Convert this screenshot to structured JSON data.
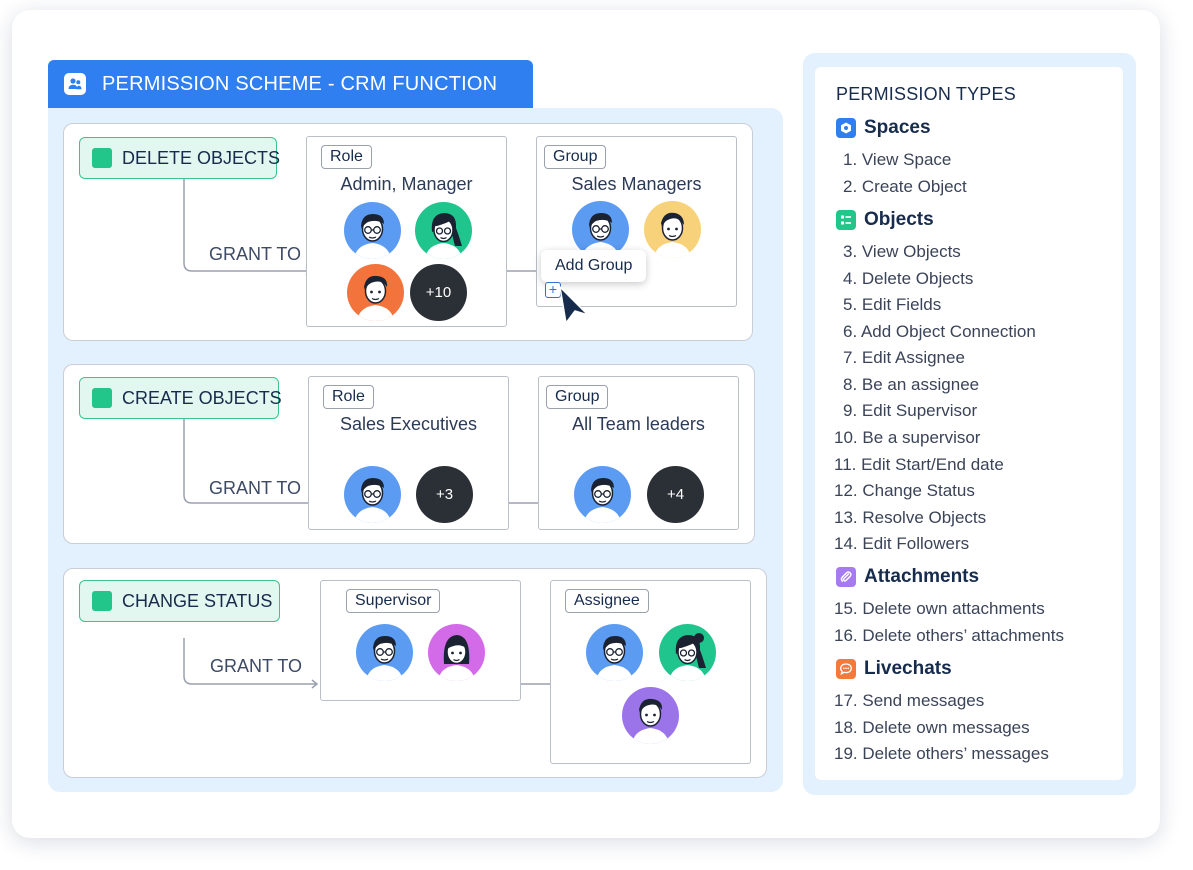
{
  "scheme": {
    "title": "PERMISSION SCHEME - CRM FUNCTION",
    "icon": "users-icon"
  },
  "grant_label": "GRANT TO",
  "sections": [
    {
      "permission": "DELETE OBJECTS",
      "left": {
        "tag": "Role",
        "title": "Admin, Manager",
        "more": "+10"
      },
      "right": {
        "tag": "Group",
        "title": "Sales Managers"
      }
    },
    {
      "permission": "CREATE OBJECTS",
      "left": {
        "tag": "Role",
        "title": "Sales Executives",
        "more": "+3"
      },
      "right": {
        "tag": "Group",
        "title": "All Team leaders",
        "more": "+4"
      }
    },
    {
      "permission": "CHANGE STATUS",
      "left": {
        "tag": "Supervisor"
      },
      "right": {
        "tag": "Assignee"
      }
    }
  ],
  "add_group_tooltip": "Add Group",
  "permission_types": {
    "title": "PERMISSION TYPES",
    "categories": [
      {
        "name": "Spaces",
        "icon": "spaces-icon",
        "color": "#2f7ff0",
        "items": [
          "1. View Space",
          "2. Create Object"
        ]
      },
      {
        "name": "Objects",
        "icon": "objects-icon",
        "color": "#22c68a",
        "items": [
          "3. View Objects",
          "4. Delete Objects",
          "5. Edit Fields",
          "6. Add Object Connection",
          "7. Edit Assignee",
          "8. Be an assignee",
          "9. Edit Supervisor",
          "10. Be a supervisor",
          "11. Edit Start/End date",
          "12. Change Status",
          "13. Resolve Objects",
          "14. Edit Followers"
        ]
      },
      {
        "name": "Attachments",
        "icon": "paperclip-icon",
        "color": "#a77bf0",
        "items": [
          "15. Delete own attachments",
          "16. Delete others’ attachments"
        ]
      },
      {
        "name": "Livechats",
        "icon": "chat-icon",
        "color": "#f57a3a",
        "items": [
          "17. Send messages",
          "18. Delete own messages",
          "19. Delete others’ messages"
        ]
      }
    ]
  }
}
